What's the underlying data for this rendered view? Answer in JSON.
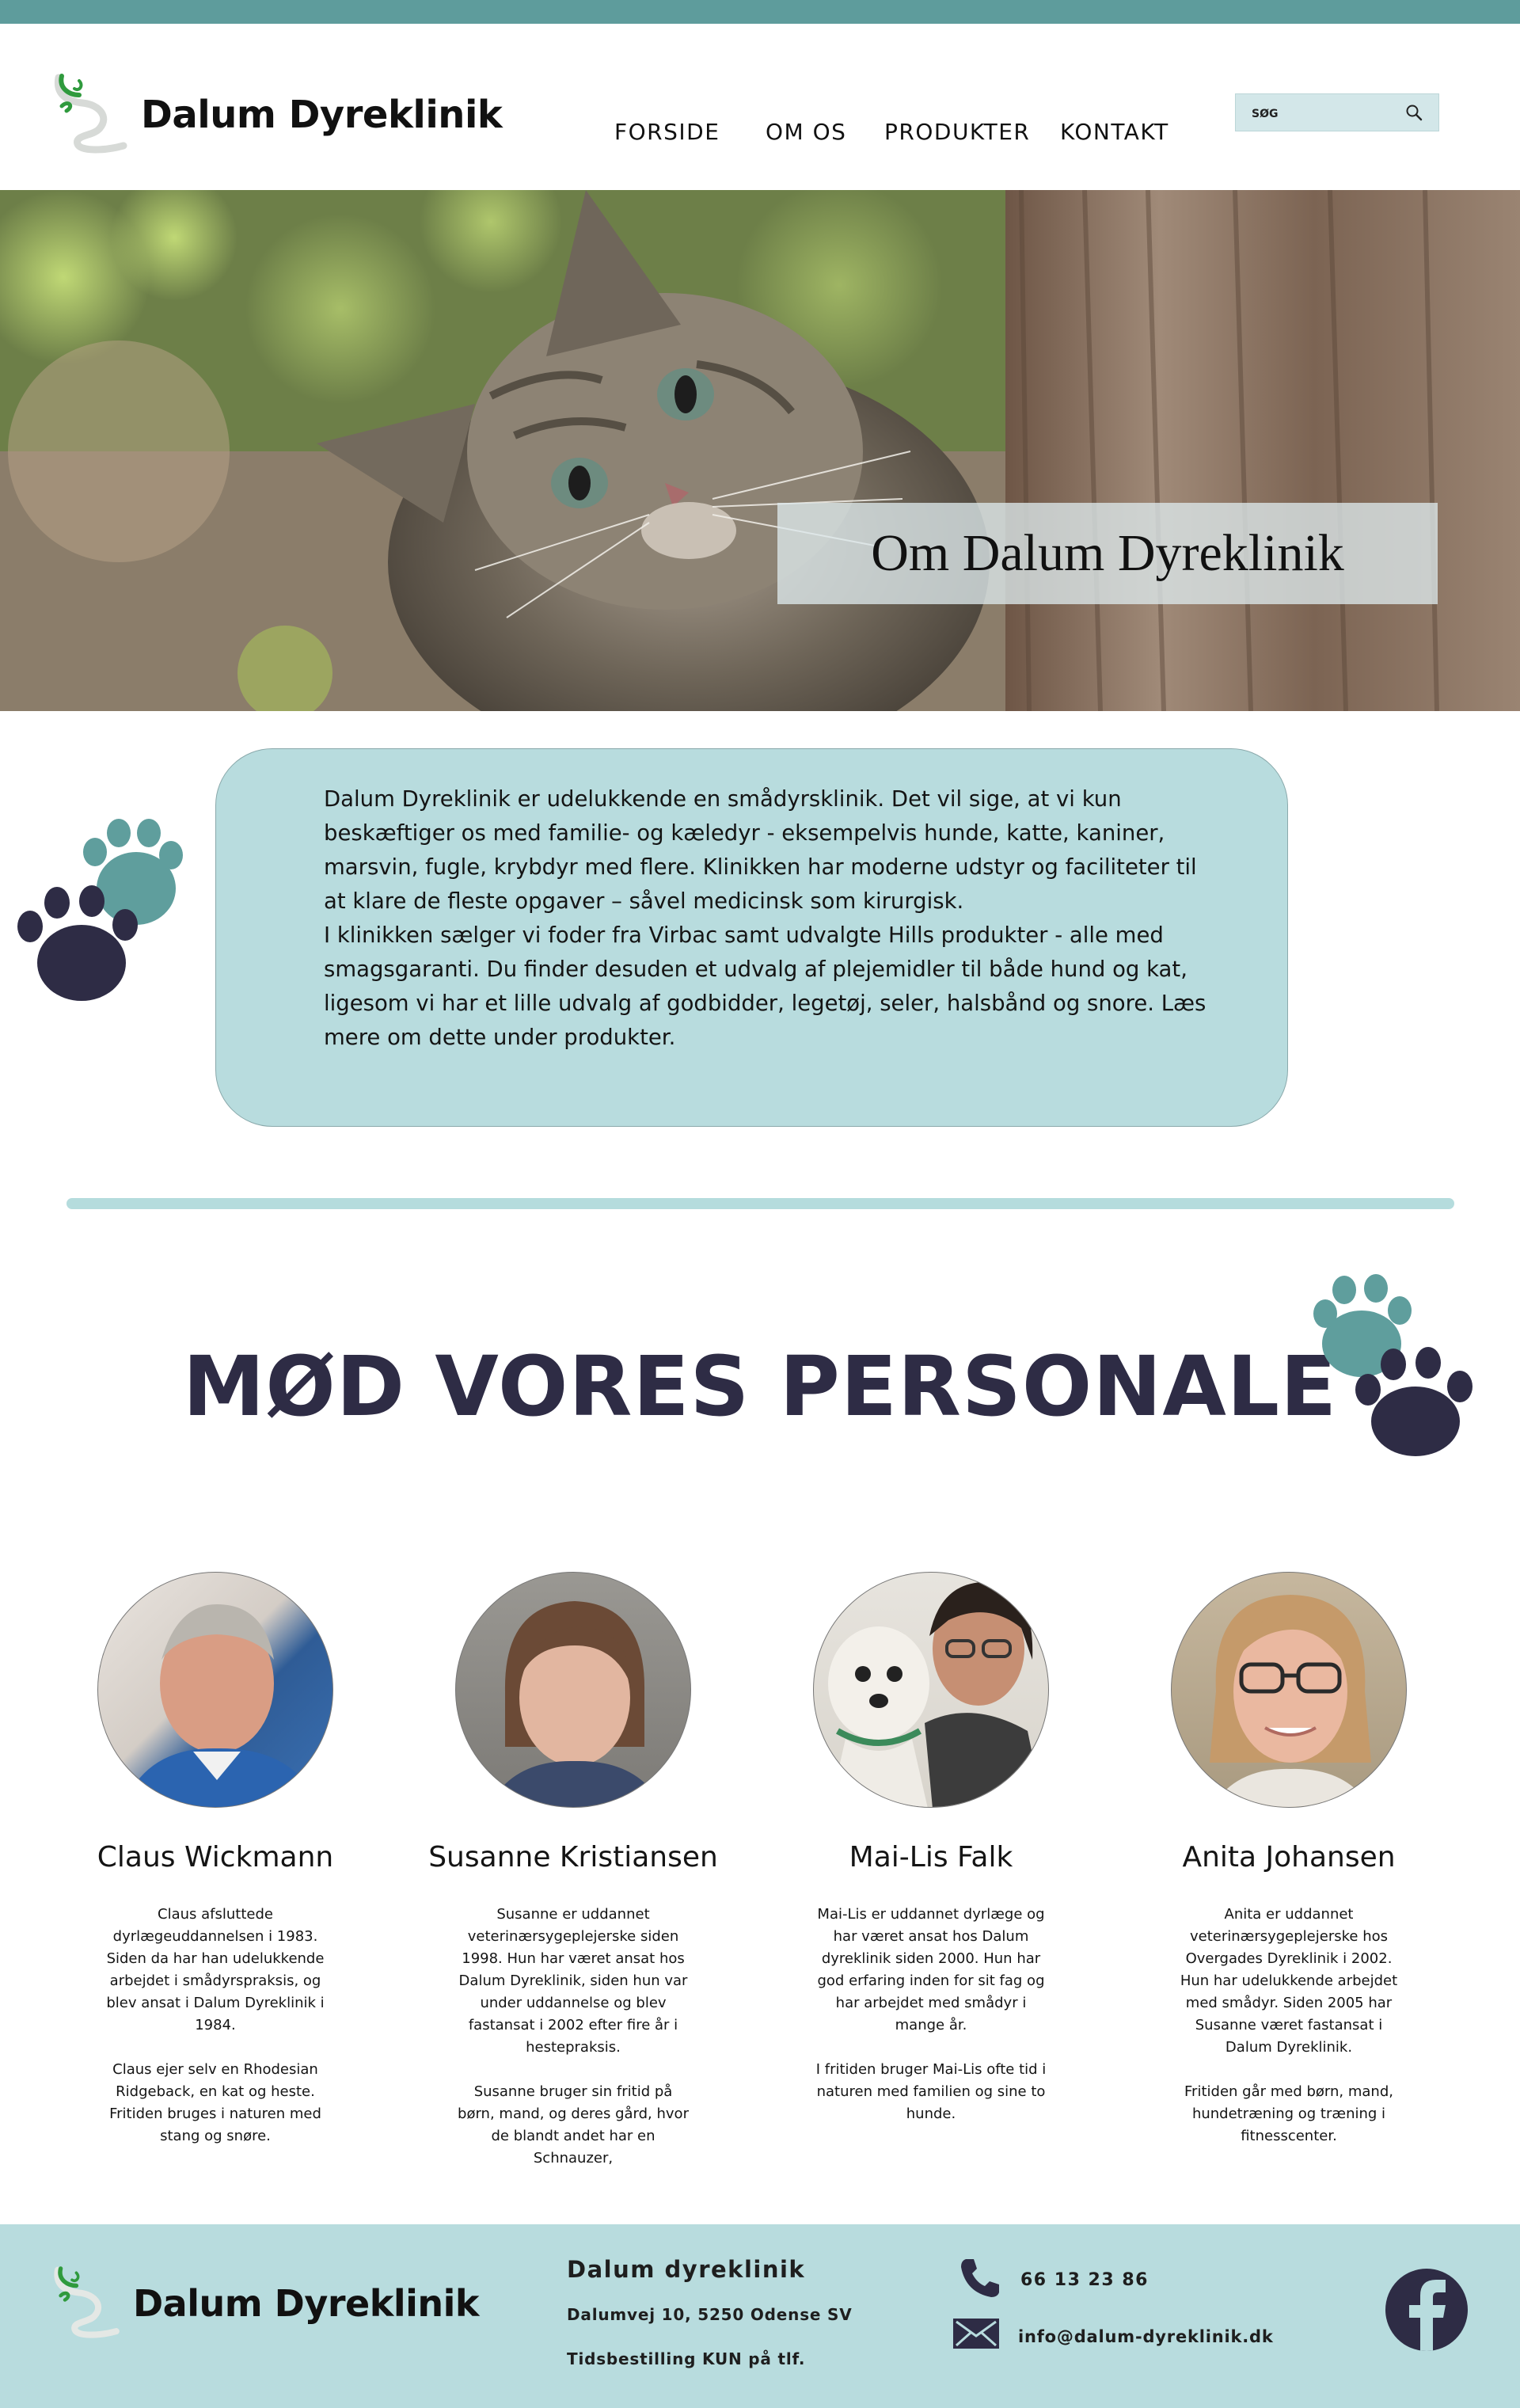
{
  "brand": {
    "name": "Dalum Dyreklinik"
  },
  "nav": {
    "items": [
      "FORSIDE",
      "OM OS",
      "PRODUKTER",
      "KONTAKT"
    ]
  },
  "search": {
    "placeholder": "SØG"
  },
  "hero": {
    "title": "Om Dalum Dyreklinik"
  },
  "about": {
    "text": "Dalum Dyreklinik er udelukkende en smådyrsklinik. Det vil sige, at vi kun beskæftiger os med familie- og kæledyr - eksempelvis hunde, katte, kaniner, marsvin, fugle, krybdyr med flere. Klinikken har moderne udstyr og faciliteter til at klare de fleste opgaver – såvel medicinsk som kirurgisk.\nI klinikken sælger vi foder fra Virbac samt udvalgte Hills produkter - alle med smagsgaranti. Du finder desuden et udvalg af plejemidler til både hund og kat, ligesom vi har et lille udvalg af godbidder, legetøj, seler, halsbånd og snore. Læs mere om dette under produkter."
  },
  "staff": {
    "title": "MØD VORES PERSONALE",
    "members": [
      {
        "name": "Claus Wickmann",
        "bio": "Claus afsluttede dyrlægeuddannelsen i 1983. Siden da har han udelukkende arbejdet i smådyrspraksis, og blev ansat i Dalum Dyreklinik i 1984.\n\nClaus ejer selv en Rhodesian Ridgeback, en kat og heste. Fritiden bruges i naturen med stang og snøre."
      },
      {
        "name": "Susanne Kristiansen",
        "bio": "Susanne er uddannet veterinærsygeplejerske siden 1998. Hun har været ansat hos Dalum Dyreklinik, siden hun var under uddannelse og blev fastansat i 2002 efter fire år i hestepraksis.\n\nSusanne bruger sin fritid på børn, mand, og deres gård, hvor de blandt andet har en Schnauzer,"
      },
      {
        "name": "Mai-Lis Falk",
        "bio": "Mai-Lis er uddannet dyrlæge og har været ansat hos Dalum dyreklinik siden 2000. Hun har god erfaring inden for sit fag og har arbejdet med smådyr i mange år.\n\nI fritiden bruger Mai-Lis ofte tid i naturen med familien og sine to hunde."
      },
      {
        "name": "Anita Johansen",
        "bio": "Anita er uddannet veterinærsygeplejerske hos Overgades Dyreklinik i 2002. Hun har udelukkende arbejdet med smådyr. Siden 2005 har Susanne været fastansat i Dalum Dyreklinik.\n\nFritiden går med børn, mand, hundetræning og træning i fitnesscenter."
      }
    ]
  },
  "footer": {
    "name": "Dalum dyreklinik",
    "address": "Dalumvej 10, 5250 Odense SV",
    "note": "Tidsbestilling KUN på tlf.",
    "phone": "66 13 23 86",
    "email": "info@dalum-dyreklinik.dk"
  },
  "icons": {
    "logo": "snake-staff-logo",
    "search": "search-icon",
    "paw": "paw-icon",
    "phone": "phone-icon",
    "mail": "mail-icon",
    "facebook": "facebook-icon"
  },
  "colors": {
    "accent": "#5e9c9c",
    "light_teal": "#b8dcde",
    "dark_navy": "#2e2c45",
    "paw_teal": "#5f9e9d"
  }
}
